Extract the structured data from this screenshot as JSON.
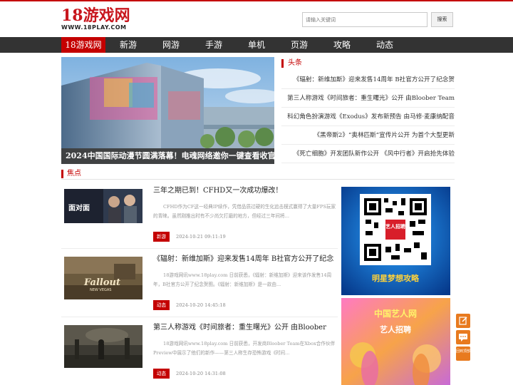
{
  "header": {
    "logo_main": "18游戏网",
    "logo_sub": "WWW.18PLAY.COM",
    "search_placeholder": "请输入关键词",
    "search_button": "搜索"
  },
  "nav": {
    "items": [
      {
        "label": "18游戏网",
        "active": true
      },
      {
        "label": "新游"
      },
      {
        "label": "网游"
      },
      {
        "label": "手游"
      },
      {
        "label": "单机"
      },
      {
        "label": "页游"
      },
      {
        "label": "攻略"
      },
      {
        "label": "动态"
      }
    ]
  },
  "hero": {
    "caption": "2024中国国际动漫节圆满落幕！电魂网络邀你一键查看收官"
  },
  "headlines": {
    "title": "头条",
    "items": [
      "《辐射：新维加斯》迎来发售14周年 B社官方公开了纪念贺",
      "第三人称游戏《时间旅者：重生曙光》公开 由Bloober Team",
      "科幻角色扮演游戏《Exodus》发布新预告 由马修·麦康纳配音",
      "《黑帝斯2》“奥林匹斯”宣传片公开 为首个大型更新",
      "《死亡细胞》开发团队新作公开 《风中行者》开启抢先体验"
    ]
  },
  "focus": {
    "title": "焦点",
    "items": [
      {
        "title": "三年之期已到！CFHD又一次成功爆改！",
        "desc": "CFHD作为CF这一经典IP续作，凭借品质过硬的生化追击模式赢得了大量FPS玩家的青睐。虽然刚推出时有不少尚欠打磨的地方，但经过三年间将...",
        "tag": "新游",
        "date": "2024-10-21 09:11:19",
        "thumb_text": "面对面"
      },
      {
        "title": "《辐射：新维加斯》迎来发售14周年 B社官方公开了纪念",
        "desc": "18游戏网讯www.18play.com 日前获悉，《辐射：新维加斯》迎来该作发售14周年，B社官方公开了纪念贺图。《辐射：新维加斯》是一款由...",
        "tag": "动态",
        "date": "2024-10-20 14:45:18",
        "thumb_text": "Fallout",
        "thumb_sub": "NEW VEGAS"
      },
      {
        "title": "第三人称游戏《时间旅者：重生曙光》公开 由Bloober",
        "desc": "18游戏网讯www.18play.com 日前获悉，开发商Bloober Team在Xbox合作伙伴Preview中展示了他们的新作——第三人称生存恐怖游戏《时间...",
        "tag": "动态",
        "date": "2024-10-20 14:31:08"
      }
    ]
  },
  "promos": {
    "qr_badge": "艺人招聘",
    "banner1": "明星梦想攻略",
    "banner2_title": "中国艺人网",
    "banner2_sub": "艺人招聘"
  },
  "float": {
    "third_label": "回到顶部"
  }
}
